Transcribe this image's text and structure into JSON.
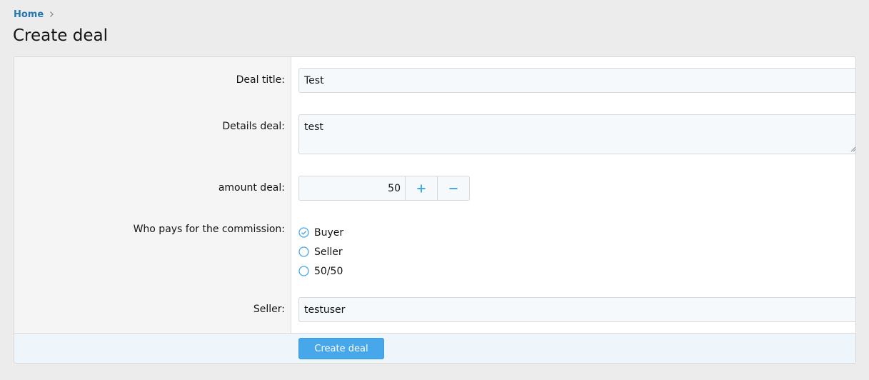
{
  "breadcrumb": {
    "home": "Home"
  },
  "page": {
    "title": "Create deal"
  },
  "form": {
    "deal_title": {
      "label": "Deal title:",
      "value": "Test"
    },
    "details": {
      "label": "Details deal:",
      "value": "test"
    },
    "amount": {
      "label": "amount deal:",
      "value": "50"
    },
    "commission": {
      "label": "Who pays for the commission:",
      "options": [
        "Buyer",
        "Seller",
        "50/50"
      ],
      "selected": "Buyer"
    },
    "seller": {
      "label": "Seller:",
      "value": "testuser"
    },
    "submit_label": "Create deal"
  },
  "colors": {
    "accent": "#47a7eb",
    "link": "#2577b1",
    "label_bg": "#f5f5f5",
    "footer_bg": "#eef5fb"
  },
  "icons": {
    "breadcrumb_separator": "chevron-right-icon",
    "increment": "plus-icon",
    "decrement": "minus-icon",
    "radio_checked": "check-circle-icon",
    "radio_unchecked": "circle-icon"
  }
}
